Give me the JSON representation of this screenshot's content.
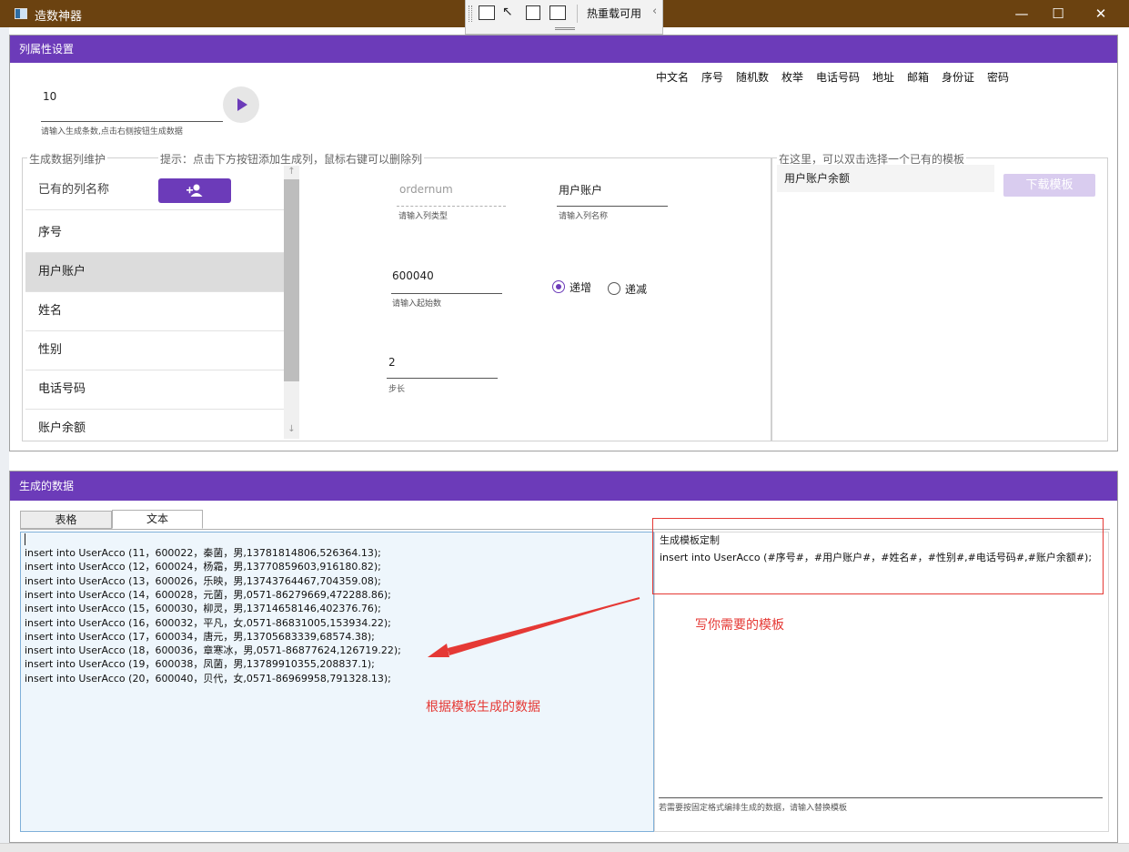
{
  "window": {
    "title": "造数神器",
    "minimize": "—",
    "maximize": "☐",
    "close": "✕"
  },
  "devbar": {
    "label": "热重载可用",
    "chevron": "‹"
  },
  "column_settings": {
    "header": "列属性设置",
    "type_links": [
      "中文名",
      "序号",
      "随机数",
      "枚举",
      "电话号码",
      "地址",
      "邮箱",
      "身份证",
      "密码"
    ],
    "count_value": "10",
    "count_hint": "请输入生成条数,点击右侧按钮生成数据",
    "maintain_title": "生成数据列维护",
    "maintain_hint": "提示：点击下方按钮添加生成列，鼠标右键可以删除列",
    "existing_columns_label": "已有的列名称",
    "columns": [
      "序号",
      "用户账户",
      "姓名",
      "性别",
      "电话号码",
      "账户余额"
    ],
    "selected_index": 1,
    "field_type_value": "ordernum",
    "field_type_hint": "请输入列类型",
    "field_name_value": "用户账户",
    "field_name_hint": "请输入列名称",
    "start_value": "600040",
    "start_hint": "请输入起始数",
    "radio_inc": "递增",
    "radio_dec": "递减",
    "step_value": "2",
    "step_hint": "步长",
    "template_group_title": "在这里，可以双击选择一个已有的模板",
    "template_item": "用户账户余额",
    "download_button": "下载模板"
  },
  "generated": {
    "header": "生成的数据",
    "tabs": [
      "表格",
      "文本"
    ],
    "active_tab": 1,
    "lines": [
      "insert into UserAcco (11，600022，秦菌，男,13781814806,526364.13);",
      "insert into UserAcco (12，600024，杨霜，男,13770859603,916180.82);",
      "insert into UserAcco (13，600026，乐映，男,13743764467,704359.08);",
      "insert into UserAcco (14，600028，元菌，男,0571-86279669,472288.86);",
      "insert into UserAcco (15，600030，柳灵，男,13714658146,402376.76);",
      "insert into UserAcco (16，600032，平凡，女,0571-86831005,153934.22);",
      "insert into UserAcco (17，600034，唐元，男,13705683339,68574.38);",
      "insert into UserAcco (18，600036，章寒冰，男,0571-86877624,126719.22);",
      "insert into UserAcco (19，600038，凤菌，男,13789910355,208837.1);",
      "insert into UserAcco (20，600040，贝代，女,0571-86969958,791328.13);"
    ],
    "template_title": "生成模板定制",
    "template_text": "insert into UserAcco (#序号#，#用户账户#，#姓名#，#性别#,#电话号码#,#账户余额#);",
    "template_hint": "若需要按固定格式编排生成的数据，请输入替换模板"
  },
  "annotations": {
    "write_template": "写你需要的模板",
    "generated_by_template": "根据模板生成的数据"
  },
  "colors": {
    "purple": "#6c3bb9",
    "titlebar": "#6b4210",
    "annotation": "#e53935"
  }
}
